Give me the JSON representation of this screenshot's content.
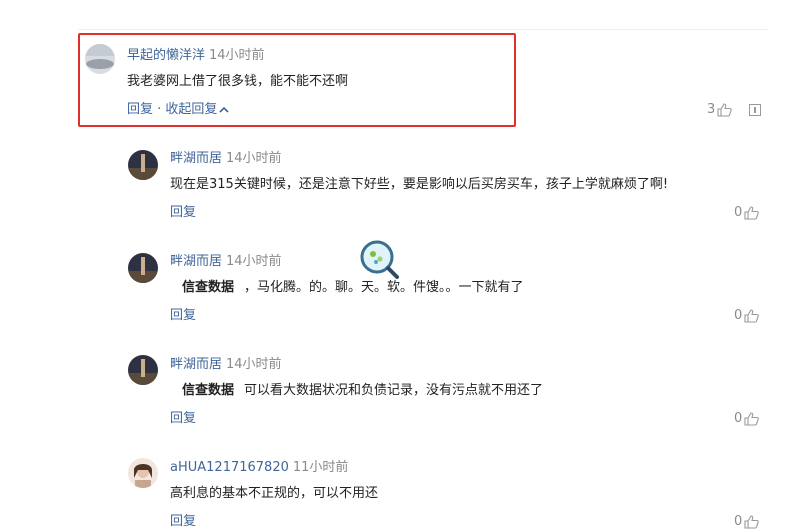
{
  "comments": [
    {
      "user": "早起的懒洋洋",
      "time": "14小时前",
      "text": "我老婆网上借了很多钱，能不能不还啊",
      "reply": "回复",
      "sep": " · ",
      "collapse": "收起回复",
      "likes": "3"
    },
    {
      "user": "畔湖而居",
      "time": "14小时前",
      "text": "现在是315关键时候，还是注意下好些，要是影响以后买房买车，孩子上学就麻烦了啊!",
      "reply": "回复",
      "likes": "0"
    },
    {
      "user": "畔湖而居",
      "time": "14小时前",
      "keyword": "信查数据",
      "text": "，马化腾。的。聊。天。软。件馊。。一下就有了",
      "reply": "回复",
      "likes": "0"
    },
    {
      "user": "畔湖而居",
      "time": "14小时前",
      "keyword": "信查数据",
      "text": "可以看大数据状况和负债记录，没有污点就不用还了",
      "reply": "回复",
      "likes": "0"
    },
    {
      "user": "aHUA1217167820",
      "time": "11小时前",
      "text": "高利息的基本不正规的，可以不用还",
      "reply": "回复",
      "likes": "0"
    }
  ],
  "colors": {
    "link": "#406599",
    "highlight": "#e0302e",
    "meta": "#8a8a8a"
  },
  "icons": [
    "thumbs-up-icon",
    "report-icon",
    "chevron-up-icon",
    "magnifier-icon"
  ]
}
